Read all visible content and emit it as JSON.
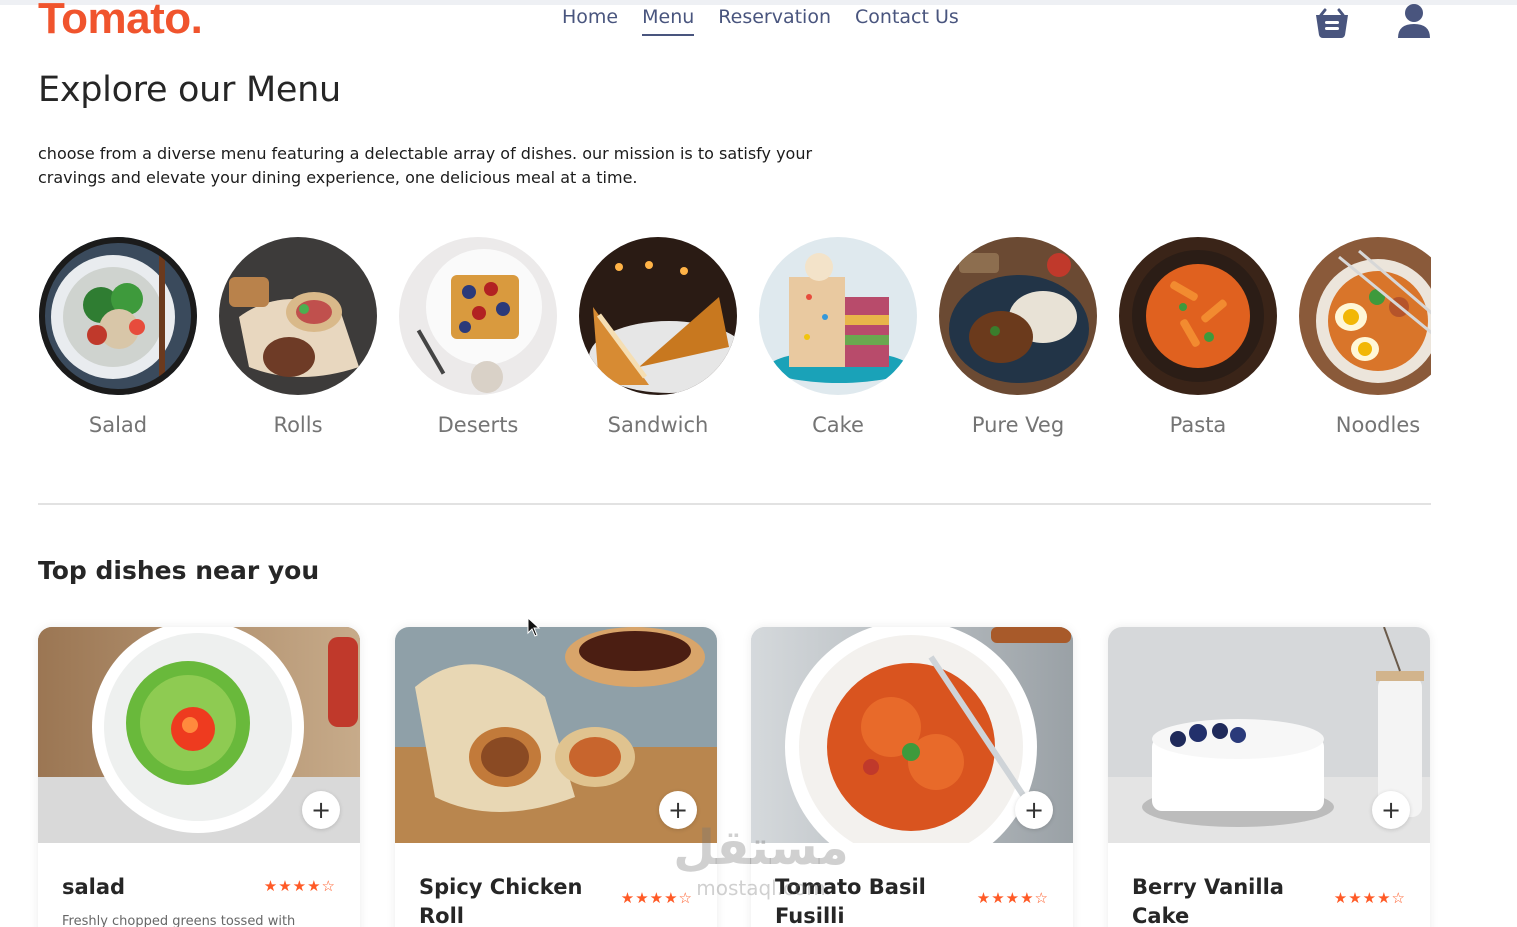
{
  "brand": {
    "logo": "Tomato.",
    "accent": "#f0542d"
  },
  "nav": {
    "items": [
      "Home",
      "Menu",
      "Reservation",
      "Contact Us"
    ],
    "active": "Menu"
  },
  "header_icons": [
    "basket-icon",
    "profile-icon"
  ],
  "explore": {
    "title": "Explore our Menu",
    "description": "choose from a diverse menu featuring a delectable array of dishes. our mission is to satisfy your cravings and elevate your dining experience, one delicious meal at a time."
  },
  "categories": [
    {
      "label": "Salad"
    },
    {
      "label": "Rolls"
    },
    {
      "label": "Deserts"
    },
    {
      "label": "Sandwich"
    },
    {
      "label": "Cake"
    },
    {
      "label": "Pure Veg"
    },
    {
      "label": "Pasta"
    },
    {
      "label": "Noodles"
    }
  ],
  "top_dishes": {
    "title": "Top dishes near you",
    "items": [
      {
        "name": "salad",
        "rating": 4,
        "max_rating": 5,
        "stars": "★★★★☆",
        "description": "Freshly chopped greens tossed with"
      },
      {
        "name": "Spicy Chicken Roll",
        "rating": 4,
        "max_rating": 5,
        "stars": "★★★★☆",
        "description": ""
      },
      {
        "name": "Tomato Basil Fusilli",
        "rating": 4,
        "max_rating": 5,
        "stars": "★★★★☆",
        "description": ""
      },
      {
        "name": "Berry Vanilla Cake",
        "rating": 4,
        "max_rating": 5,
        "stars": "★★★★☆",
        "description": ""
      }
    ],
    "add_label": "+"
  },
  "watermark": {
    "text": "مستقل",
    "sub": "mostaql.com"
  }
}
